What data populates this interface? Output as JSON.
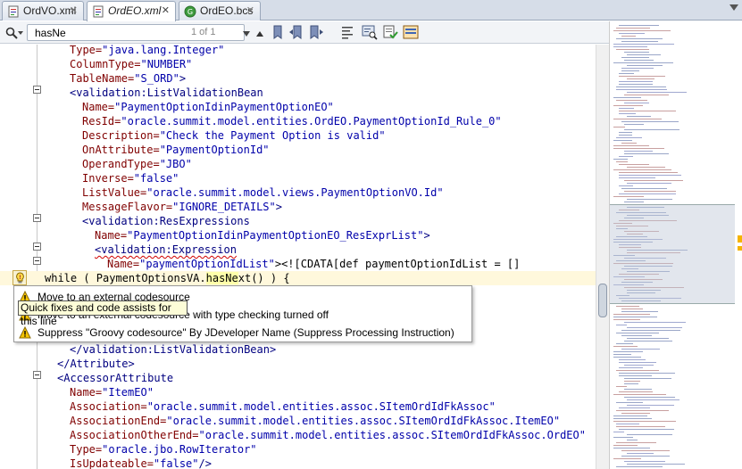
{
  "tabs": [
    {
      "label": "OrdVO.xml",
      "active": false,
      "italic": false,
      "icon": "xml-file-icon"
    },
    {
      "label": "OrdEO.xml",
      "active": true,
      "italic": true,
      "icon": "xml-file-icon"
    },
    {
      "label": "OrdEO.bcs",
      "active": false,
      "italic": false,
      "icon": "bc-source-icon"
    }
  ],
  "toolbar": {
    "search_value": "hasNe",
    "match_count": "1 of 1"
  },
  "code": {
    "l0": {
      "attr": "Type=",
      "val": "\"java.lang.Integer\""
    },
    "l1": {
      "attr": "ColumnType=",
      "val": "\"NUMBER\""
    },
    "l2": {
      "attr": "TableName=",
      "val": "\"S_ORD\"",
      "tail": ">"
    },
    "l3": {
      "tag": "<validation:ListValidationBean"
    },
    "l4": {
      "attr": "Name=",
      "val": "\"PaymentOptionIdinPaymentOptionEO\""
    },
    "l5": {
      "attr": "ResId=",
      "val": "\"oracle.summit.model.entities.OrdEO.PaymentOptionId_Rule_0\""
    },
    "l6": {
      "attr": "Description=",
      "val": "\"Check the Payment Option is valid\""
    },
    "l7": {
      "attr": "OnAttribute=",
      "val": "\"PaymentOptionId\""
    },
    "l8": {
      "attr": "OperandType=",
      "val": "\"JBO\""
    },
    "l9": {
      "attr": "Inverse=",
      "val": "\"false\""
    },
    "l10": {
      "attr": "ListValue=",
      "val": "\"oracle.summit.model.views.PaymentOptionVO.Id\""
    },
    "l11": {
      "attr": "MessageFlavor=",
      "val": "\"IGNORE_DETAILS\"",
      "tail": ">"
    },
    "l12": {
      "tag": "<validation:ResExpressions"
    },
    "l13": {
      "attr": "Name=",
      "val": "\"PaymentOptionIdinPaymentOptionEO_ResExprList\"",
      "tail": ">"
    },
    "l14": {
      "tag": "<validation:Expression"
    },
    "l15": {
      "attr": "Name=",
      "val": "\"paymentOptionIdList\"",
      "tail": "><![CDATA[def paymentOptionIdList = []"
    },
    "l16": {
      "pre": "while ( PaymentOptionsVA.",
      "hl": "hasNe",
      "post": "xt() ) {"
    },
    "l22": {
      "tag": "</validation:ListValidationBean>"
    },
    "l23": {
      "tag": "</Attribute>"
    },
    "l24": {
      "tag": "<AccessorAttribute"
    },
    "l25": {
      "attr": "Name=",
      "val": "\"ItemEO\""
    },
    "l26": {
      "attr": "Association=",
      "val": "\"oracle.summit.model.entities.assoc.SItemOrdIdFkAssoc\""
    },
    "l27": {
      "attr": "AssociationEnd=",
      "val": "\"oracle.summit.model.entities.assoc.SItemOrdIdFkAssoc.ItemEO\""
    },
    "l28": {
      "attr": "AssociationOtherEnd=",
      "val": "\"oracle.summit.model.entities.assoc.SItemOrdIdFkAssoc.OrdEO\""
    },
    "l29": {
      "attr": "Type=",
      "val": "\"oracle.jbo.RowIterator\""
    },
    "l30": {
      "attr": "IsUpdateable=",
      "val": "\"false\"",
      "tail": "/>"
    }
  },
  "quickfix": {
    "tooltip": "Quick fixes and code assists for this line",
    "items": [
      {
        "label": "Move to an external codesource",
        "icon": "warning-icon"
      },
      {
        "label": "Move to an external codesource with type checking turned off",
        "icon": "warning-icon"
      },
      {
        "label": "Suppress \"Groovy codesource\" By JDeveloper Name (Suppress Processing Instruction)",
        "icon": "warning-icon"
      }
    ]
  },
  "colors": {
    "tag": "#000080",
    "attribute": "#800000",
    "value": "#0000aa",
    "current_line": "#fff8dc",
    "search_highlight": "#ffffaa",
    "warning": "#f5b400"
  }
}
